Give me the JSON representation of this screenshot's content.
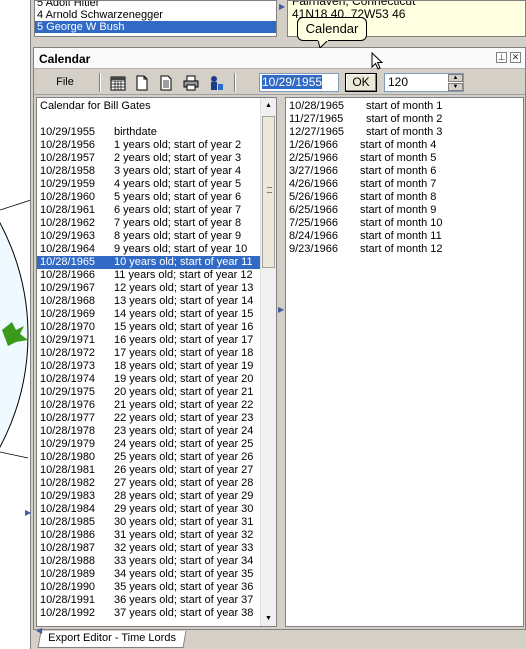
{
  "people_list": {
    "items": [
      "5 Adolf Hitler",
      "4 Arnold Schwarzenegger",
      "5 George W Bush"
    ],
    "selected_index": 2
  },
  "location_panel": {
    "lines": [
      "Fairhaven, Connecticut",
      "41N18 40, 72W53 46"
    ]
  },
  "tooltip": {
    "text": "Calendar"
  },
  "calendar": {
    "title": "Calendar",
    "toolbar": {
      "file_label": "File",
      "date_value": "10/29/1955",
      "ok_label": "OK",
      "months_value": "120",
      "icons": [
        "calendar-grid-icon",
        "new-document-icon",
        "document-text-icon",
        "print-icon",
        "person-export-icon"
      ]
    },
    "years_list": {
      "title": "Calendar for Bill Gates",
      "selected_index": 9,
      "rows": [
        {
          "date": "10/29/1955",
          "text": "birthdate"
        },
        {
          "date": "10/28/1956",
          "text": "1 years old; start of year 2"
        },
        {
          "date": "10/28/1957",
          "text": "2 years old; start of year 3"
        },
        {
          "date": "10/28/1958",
          "text": "3 years old; start of year 4"
        },
        {
          "date": "10/29/1959",
          "text": "4 years old; start of year 5"
        },
        {
          "date": "10/28/1960",
          "text": "5 years old; start of year 6"
        },
        {
          "date": "10/28/1961",
          "text": "6 years old; start of year 7"
        },
        {
          "date": "10/28/1962",
          "text": "7 years old; start of year 8"
        },
        {
          "date": "10/29/1963",
          "text": "8 years old; start of year 9"
        },
        {
          "date": "10/28/1964",
          "text": "9 years old; start of year 10"
        },
        {
          "date": "10/28/1965",
          "text": "10 years old; start of year 11"
        },
        {
          "date": "10/28/1966",
          "text": "11 years old; start of year 12"
        },
        {
          "date": "10/29/1967",
          "text": "12 years old; start of year 13"
        },
        {
          "date": "10/28/1968",
          "text": "13 years old; start of year 14"
        },
        {
          "date": "10/28/1969",
          "text": "14 years old; start of year 15"
        },
        {
          "date": "10/28/1970",
          "text": "15 years old; start of year 16"
        },
        {
          "date": "10/29/1971",
          "text": "16 years old; start of year 17"
        },
        {
          "date": "10/28/1972",
          "text": "17 years old; start of year 18"
        },
        {
          "date": "10/28/1973",
          "text": "18 years old; start of year 19"
        },
        {
          "date": "10/28/1974",
          "text": "19 years old; start of year 20"
        },
        {
          "date": "10/29/1975",
          "text": "20 years old; start of year 21"
        },
        {
          "date": "10/28/1976",
          "text": "21 years old; start of year 22"
        },
        {
          "date": "10/28/1977",
          "text": "22 years old; start of year 23"
        },
        {
          "date": "10/28/1978",
          "text": "23 years old; start of year 24"
        },
        {
          "date": "10/29/1979",
          "text": "24 years old; start of year 25"
        },
        {
          "date": "10/28/1980",
          "text": "25 years old; start of year 26"
        },
        {
          "date": "10/28/1981",
          "text": "26 years old; start of year 27"
        },
        {
          "date": "10/28/1982",
          "text": "27 years old; start of year 28"
        },
        {
          "date": "10/29/1983",
          "text": "28 years old; start of year 29"
        },
        {
          "date": "10/28/1984",
          "text": "29 years old; start of year 30"
        },
        {
          "date": "10/28/1985",
          "text": "30 years old; start of year 31"
        },
        {
          "date": "10/28/1986",
          "text": "31 years old; start of year 32"
        },
        {
          "date": "10/28/1987",
          "text": "32 years old; start of year 33"
        },
        {
          "date": "10/28/1988",
          "text": "33 years old; start of year 34"
        },
        {
          "date": "10/28/1989",
          "text": "34 years old; start of year 35"
        },
        {
          "date": "10/28/1990",
          "text": "35 years old; start of year 36"
        },
        {
          "date": "10/28/1991",
          "text": "36 years old; start of year 37"
        },
        {
          "date": "10/28/1992",
          "text": "37 years old; start of year 38"
        }
      ]
    },
    "months_list": {
      "rows": [
        {
          "date": "10/28/1965",
          "text": "start of month 1"
        },
        {
          "date": "11/27/1965",
          "text": "start of month 2"
        },
        {
          "date": "12/27/1965",
          "text": "start of month 3"
        },
        {
          "date": "1/26/1966",
          "text": "start of month 4"
        },
        {
          "date": "2/25/1966",
          "text": "start of month 5"
        },
        {
          "date": "3/27/1966",
          "text": "start of month 6"
        },
        {
          "date": "4/26/1966",
          "text": "start of month 7"
        },
        {
          "date": "5/26/1966",
          "text": "start of month 8"
        },
        {
          "date": "6/25/1966",
          "text": "start of month 9"
        },
        {
          "date": "7/25/1966",
          "text": "start of month 10"
        },
        {
          "date": "8/24/1966",
          "text": "start of month 11"
        },
        {
          "date": "9/23/1966",
          "text": "start of month 12"
        }
      ]
    }
  },
  "bottom_tabs": {
    "export_tab_label": "Export Editor - Time Lords"
  },
  "colors": {
    "selection": "#316ac5",
    "tooltip_bg": "#ffffe1",
    "panel_bg": "#d4d0c8"
  }
}
